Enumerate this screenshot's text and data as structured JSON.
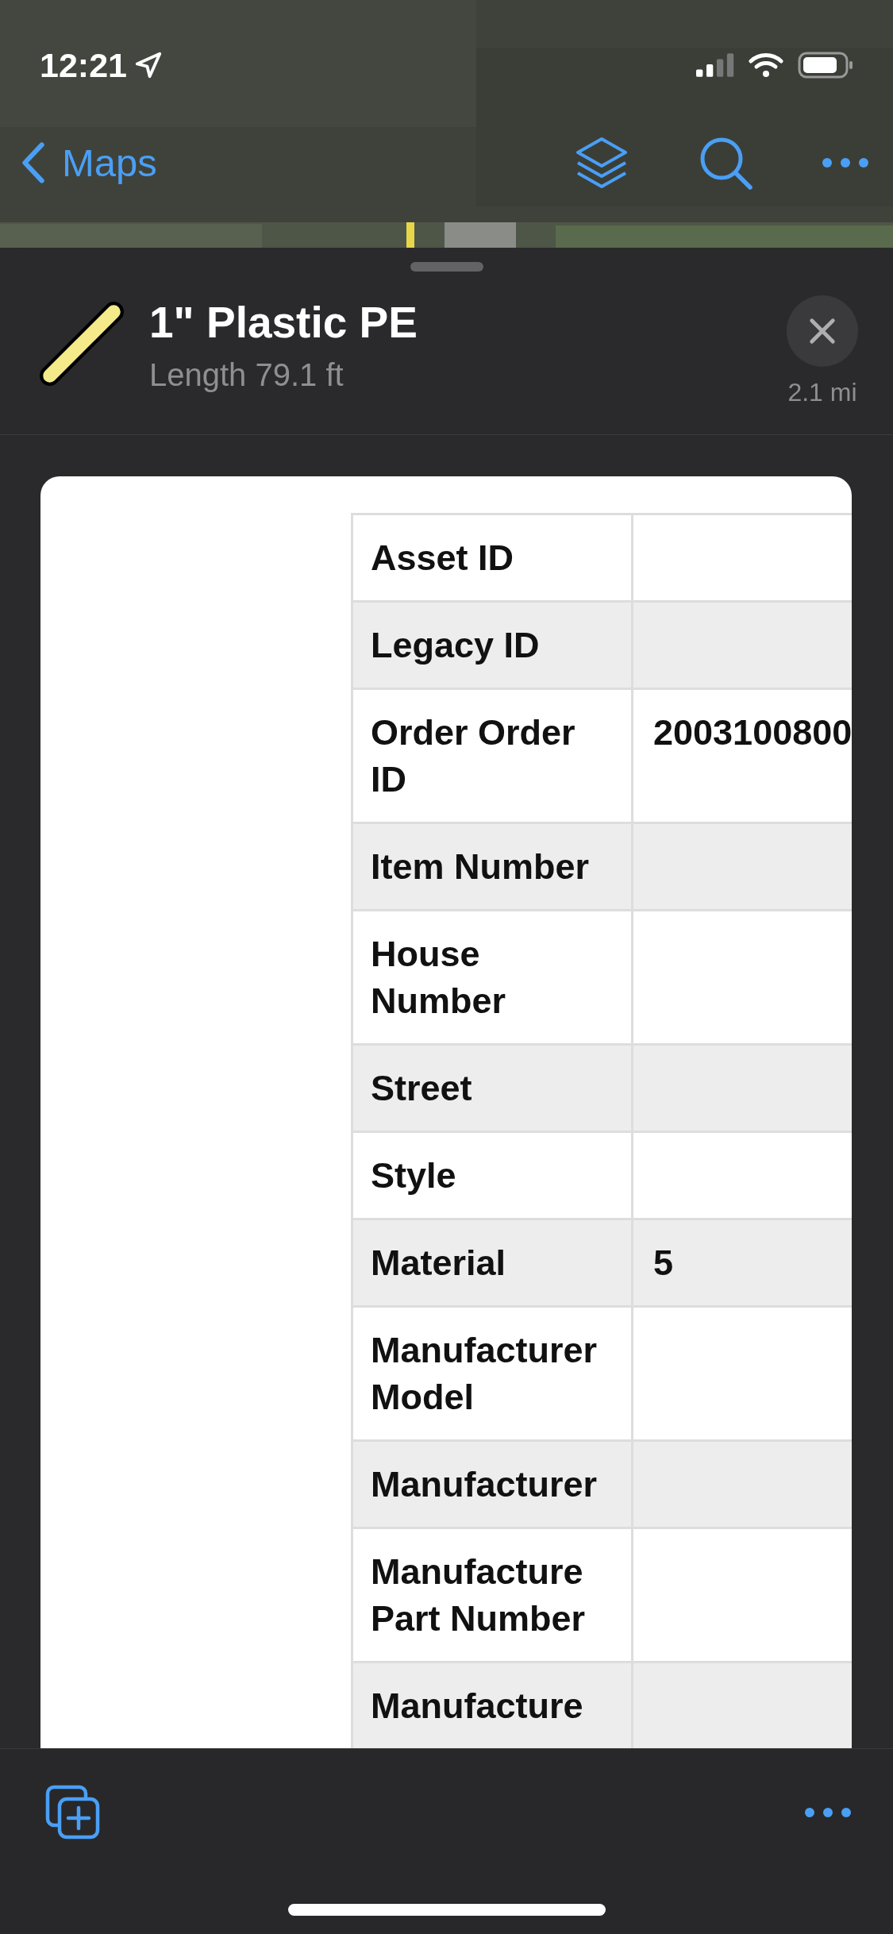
{
  "status_bar": {
    "time": "12:21"
  },
  "nav_bar": {
    "back_label": "Maps"
  },
  "feature": {
    "title": "1\" Plastic PE",
    "subtitle": "Length 79.1 ft",
    "distance": "2.1 mi"
  },
  "table": {
    "rows": [
      {
        "label": "Asset ID",
        "value": ""
      },
      {
        "label": "Legacy ID",
        "value": ""
      },
      {
        "label": "Order Order ID",
        "value": "2003100800"
      },
      {
        "label": "Item Number",
        "value": ""
      },
      {
        "label": "House Number",
        "value": ""
      },
      {
        "label": "Street",
        "value": ""
      },
      {
        "label": "Style",
        "value": ""
      },
      {
        "label": "Material",
        "value": "5"
      },
      {
        "label": "Manufacturer Model",
        "value": ""
      },
      {
        "label": "Manufacturer",
        "value": ""
      },
      {
        "label": "Manufacture Part Number",
        "value": ""
      },
      {
        "label": "Manufacture",
        "value": ""
      }
    ]
  }
}
